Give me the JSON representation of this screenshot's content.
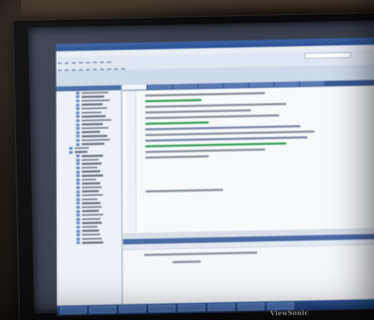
{
  "monitor": {
    "brand": "ViewSonic"
  },
  "colors": {
    "titlebar": "#2b4f93",
    "taskbar": "#203f7a",
    "editor_bg": "#f7f9fb",
    "code_text": "#6b7380"
  },
  "icons": [
    "toolbar-icon",
    "tree-file-icon"
  ]
}
